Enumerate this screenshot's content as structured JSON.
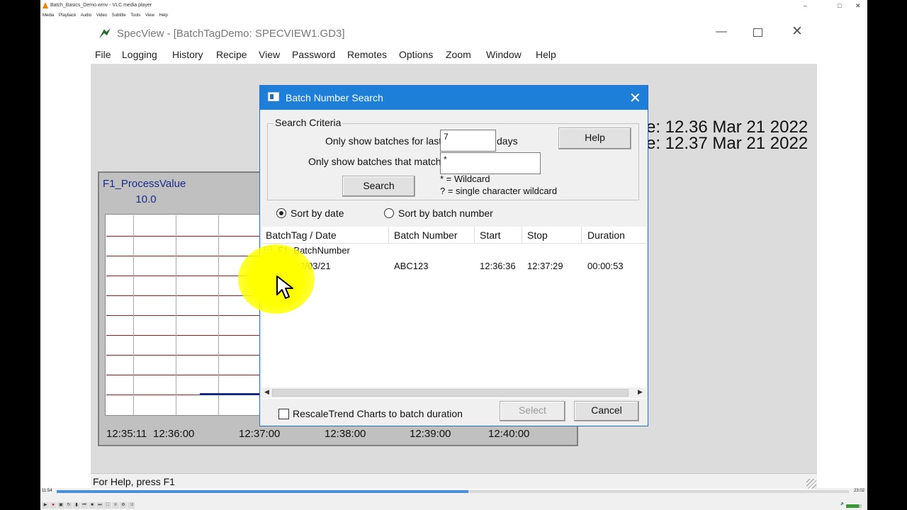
{
  "vlc": {
    "title": "Batch_Basics_Demo.wmv - VLC media player",
    "window_controls": [
      "–",
      "□",
      "✕"
    ],
    "menu": [
      "Media",
      "Playback",
      "Audio",
      "Video",
      "Subtitle",
      "Tools",
      "View",
      "Help"
    ],
    "elapsed": "11:54",
    "total": "23:02",
    "progress_fraction": 0.52,
    "volume": "100%"
  },
  "specview": {
    "title": "SpecView - [BatchTagDemo: SPECVIEW1.GD3]",
    "window_controls": [
      "—",
      "✕"
    ],
    "menu": [
      "File",
      "Logging",
      "History",
      "Recipe",
      "View",
      "Password",
      "Remotes",
      "Options",
      "Zoom",
      "Window",
      "Help"
    ],
    "status": "For Help, press F1",
    "timestamps": [
      "e: 12.36 Mar 21 2022",
      "e: 12.37 Mar 21 2022"
    ]
  },
  "trend": {
    "tag": "F1_ProcessValue",
    "value": "10.0",
    "x_ticks": [
      "12:35:11",
      "12:36:00",
      "12:37:00",
      "12:38:00",
      "12:39:00",
      "12:40:00"
    ]
  },
  "dialog": {
    "title": "Batch Number Search",
    "close": "✕",
    "criteria_legend": "Search Criteria",
    "last_label": "Only show batches for last:",
    "last_value": "7",
    "days_label": "days",
    "match_label": "Only show batches that match:",
    "match_value": "*",
    "help_button": "Help",
    "search_button": "Search",
    "wildcard_note_1": "* = Wildcard",
    "wildcard_note_2": "? = single character wildcard",
    "sort_by_date": "Sort by date",
    "sort_by_batch": "Sort by batch number",
    "columns": [
      "BatchTag / Date",
      "Batch Number",
      "Start",
      "Stop",
      "Duration"
    ],
    "tree": {
      "node": "F1_BatchNumber",
      "expander": "−",
      "rows": [
        {
          "date": "22/03/21",
          "batch": "ABC123",
          "start": "12:36:36",
          "stop": "12:37:29",
          "duration": "00:00:53"
        }
      ]
    },
    "scroll_left": "◀",
    "scroll_right": "▶",
    "rescale_label": "RescaleTrend Charts to batch duration",
    "select_button": "Select",
    "cancel_button": "Cancel"
  }
}
